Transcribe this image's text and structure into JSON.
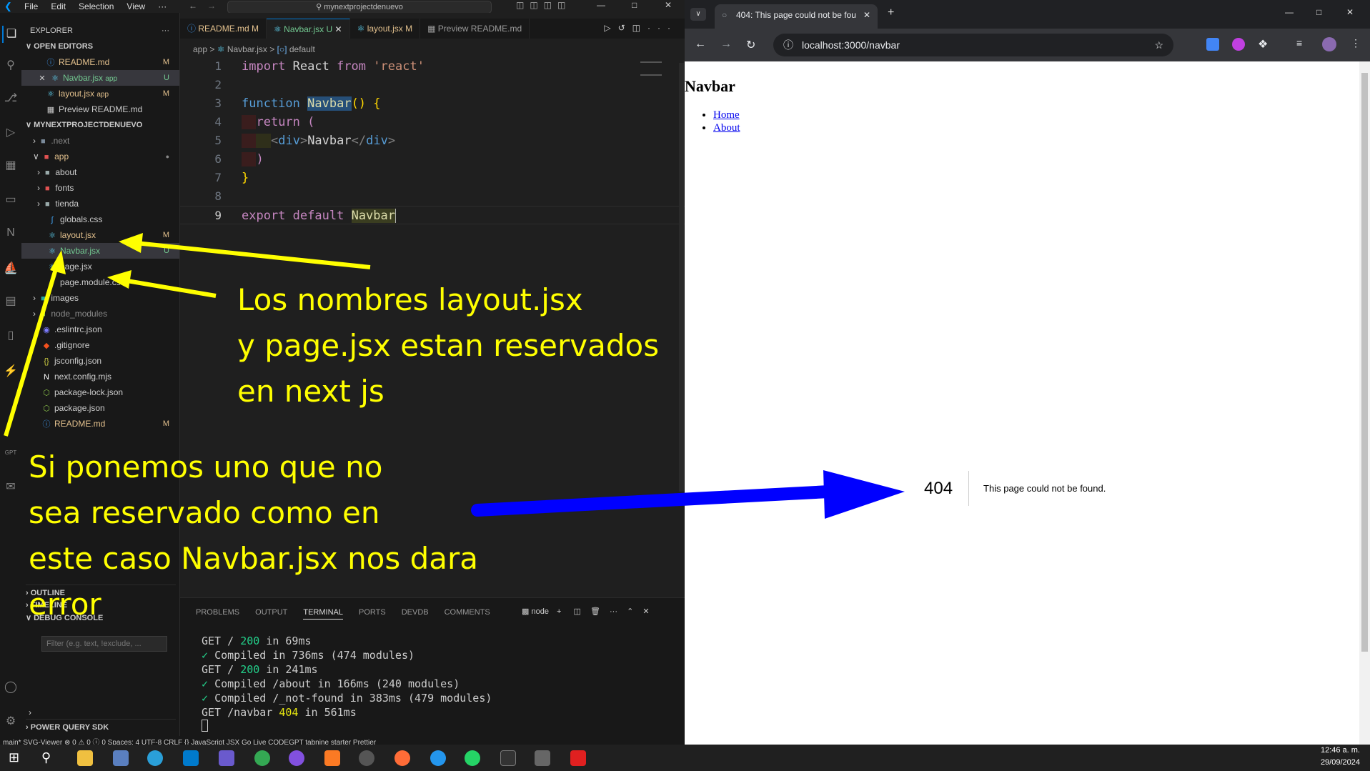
{
  "vscode": {
    "menu": [
      "File",
      "Edit",
      "Selection",
      "View",
      "···"
    ],
    "command_center": "mynextprojectdenuevo",
    "explorer_title": "EXPLORER",
    "open_editors_title": "OPEN EDITORS",
    "open_editors": [
      {
        "name": "README.md",
        "extra": "",
        "status": "M"
      },
      {
        "name": "Navbar.jsx",
        "extra": "app",
        "status": "U"
      },
      {
        "name": "layout.jsx",
        "extra": "app",
        "status": "M"
      },
      {
        "name": "Preview README.md",
        "extra": "",
        "status": ""
      }
    ],
    "project_title": "MYNEXTPROJECTDENUEVO",
    "tree": [
      {
        "name": ".next",
        "status": ""
      },
      {
        "name": "app",
        "status": "●"
      },
      {
        "name": "about",
        "status": ""
      },
      {
        "name": "fonts",
        "status": ""
      },
      {
        "name": "tienda",
        "status": ""
      },
      {
        "name": "globals.css",
        "status": ""
      },
      {
        "name": "layout.jsx",
        "status": "M"
      },
      {
        "name": "Navbar.jsx",
        "status": "U"
      },
      {
        "name": "page.jsx",
        "status": ""
      },
      {
        "name": "page.module.css",
        "status": ""
      },
      {
        "name": "images",
        "status": ""
      },
      {
        "name": "node_modules",
        "status": ""
      },
      {
        "name": ".eslintrc.json",
        "status": ""
      },
      {
        "name": ".gitignore",
        "status": ""
      },
      {
        "name": "jsconfig.json",
        "status": ""
      },
      {
        "name": "next.config.mjs",
        "status": ""
      },
      {
        "name": "package-lock.json",
        "status": ""
      },
      {
        "name": "package.json",
        "status": ""
      },
      {
        "name": "README.md",
        "status": "M"
      }
    ],
    "outline_title": "OUTLINE",
    "timeline_title": "TIMELINE",
    "debug_title": "DEBUG CONSOLE",
    "filter_placeholder": "Filter (e.g. text, !exclude, ...",
    "power_query": "POWER QUERY SDK",
    "tabs": [
      {
        "name": "README.md",
        "status": "M"
      },
      {
        "name": "Navbar.jsx",
        "status": "U"
      },
      {
        "name": "layout.jsx",
        "status": "M"
      },
      {
        "name": "Preview README.md",
        "status": ""
      }
    ],
    "breadcrumb": [
      "app",
      ">",
      "Navbar.jsx",
      ">",
      "default"
    ],
    "panel_tabs": [
      "PROBLEMS",
      "OUTPUT",
      "TERMINAL",
      "PORTS",
      "DEVDB",
      "COMMENTS"
    ],
    "panel_node": "node",
    "terminal": [
      {
        "pre": "GET / ",
        "code": "200",
        "post": " in 69ms"
      },
      {
        "pre": "✓ ",
        "code": "",
        "post": "Compiled in 736ms (474 modules)"
      },
      {
        "pre": "GET / ",
        "code": "200",
        "post": " in 241ms"
      },
      {
        "pre": "✓ ",
        "code": "",
        "post": "Compiled /about in 166ms (240 modules)"
      },
      {
        "pre": "✓ ",
        "code": "",
        "post": "Compiled /_not-found in 383ms (479 modules)"
      },
      {
        "pre": "GET /navbar ",
        "code": "404",
        "post": " in 561ms"
      }
    ],
    "status_bar": "main*   SVG-Viewer   ⊗ 0 ⚠ 0   ⓘ 0        Spaces: 4   UTF-8   CRLF   {} JavaScript JSX   Go Live   CODEGPT   tabnine starter   Prettier"
  },
  "browser": {
    "tab_title": "404: This page could not be fou",
    "url": "localhost:3000/navbar",
    "page_heading": "Navbar",
    "links": [
      "Home",
      "About"
    ],
    "error_code": "404",
    "error_text": "This page could not be found."
  },
  "annotations": {
    "reserved": [
      "Los nombres layout.jsx",
      "y page.jsx estan reservados",
      "en next js"
    ],
    "error": [
      "Si ponemos uno que no",
      "sea reservado como en",
      "este caso Navbar.jsx nos dara",
      "error"
    ]
  },
  "taskbar": {
    "time": "12:46 a. m.",
    "date": "29/09/2024"
  },
  "colors": {
    "accent": "#0078d4",
    "annotation": "#ffff00",
    "arrow": "#0000ff"
  }
}
